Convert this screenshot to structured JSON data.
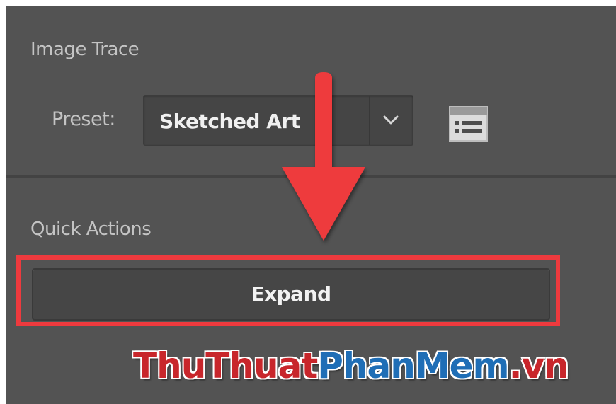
{
  "panel": {
    "image_trace_title": "Image Trace",
    "preset_label": "Preset:",
    "preset_value": "Sketched Art",
    "quick_actions_title": "Quick Actions",
    "expand_label": "Expand"
  },
  "icons": {
    "dropdown": "chevron-down-icon",
    "options": "trace-options-icon",
    "annotation": "arrow-down-icon"
  },
  "watermark": {
    "part1": "ThuThuat",
    "part2": "PhanMem",
    "part3": ".vn"
  },
  "colors": {
    "panel_bg": "#535353",
    "highlight": "#ee3a3e",
    "watermark_red": "#c8262b",
    "watermark_blue": "#1f6eb6"
  }
}
